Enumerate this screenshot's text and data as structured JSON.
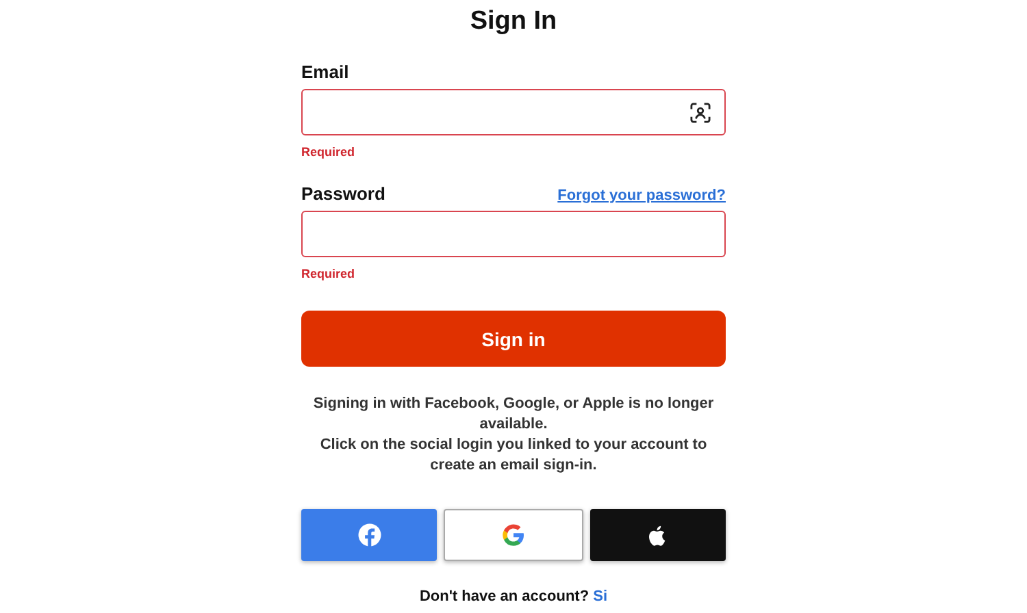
{
  "title": "Sign In",
  "fields": [
    {
      "kind": "email",
      "label": "Email",
      "error": "Required",
      "invalid": true
    },
    {
      "kind": "password",
      "label": "Password",
      "link": "Forgot your password?",
      "error": "Required",
      "invalid": true
    }
  ],
  "submit": "Sign in",
  "notice": [
    "Signing in with Facebook, Google, or Apple is no longer available.",
    "Click on the social login you linked to your account to create an email sign-in."
  ],
  "social": [
    {
      "kind": "facebook"
    },
    {
      "kind": "google"
    },
    {
      "kind": "apple"
    }
  ],
  "footer": {
    "text": "Don't have an account?",
    "link": "Si"
  }
}
